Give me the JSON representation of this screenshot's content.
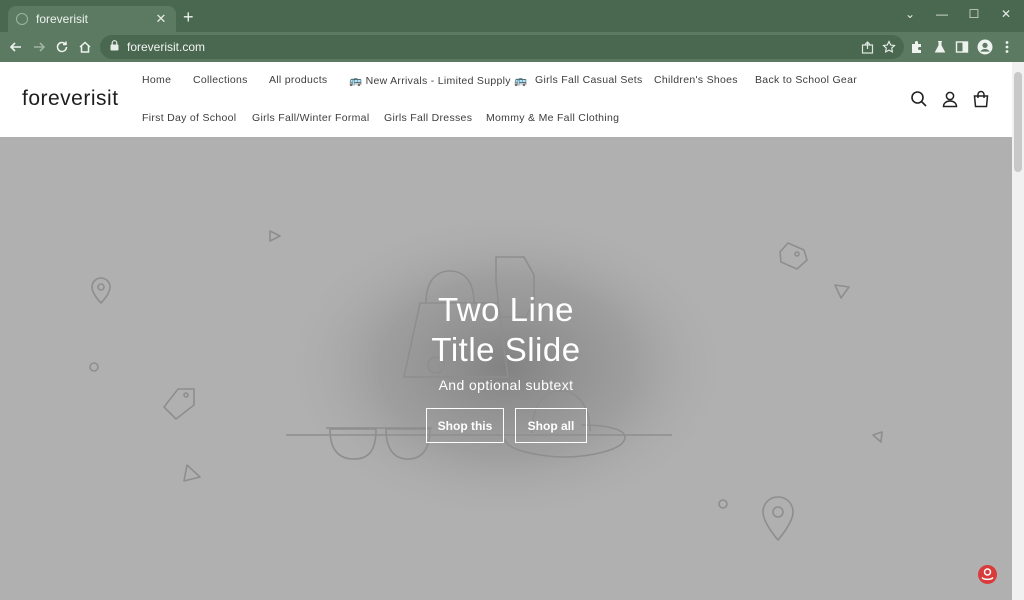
{
  "browser": {
    "tab_title": "foreverisit",
    "tab_close": "✕",
    "new_tab": "+",
    "url": "foreverisit.com",
    "window_controls": {
      "chevron": "⌄",
      "minimize": "—",
      "maximize": "☐",
      "close": "✕"
    },
    "icons": [
      "back-icon",
      "forward-icon",
      "reload-icon",
      "home-icon",
      "lock-icon",
      "share-icon",
      "star-icon",
      "extensions-icon",
      "labs-icon",
      "sidebar-icon",
      "profile-icon",
      "menu-icon"
    ]
  },
  "store": {
    "logo": "foreverisit",
    "nav": [
      "Home",
      "Collections",
      "All products",
      "🚌 New Arrivals - Limited Supply 🚌",
      "Girls Fall Casual Sets",
      "Children's Shoes",
      "Back to School Gear",
      "First Day of School",
      "Girls Fall/Winter Formal",
      "Girls Fall Dresses",
      "Mommy & Me Fall Clothing"
    ],
    "header_icons": [
      "search-icon",
      "account-icon",
      "cart-icon"
    ]
  },
  "hero": {
    "title_line1": "Two Line",
    "title_line2": "Title Slide",
    "subtext": "And optional subtext",
    "button_primary": "Shop this",
    "button_secondary": "Shop all",
    "background_color": "#b0b0b0"
  },
  "colors": {
    "browser_frame": "#4a6850",
    "browser_toolbar": "#5c7a62",
    "badge": "#d93b3b"
  }
}
